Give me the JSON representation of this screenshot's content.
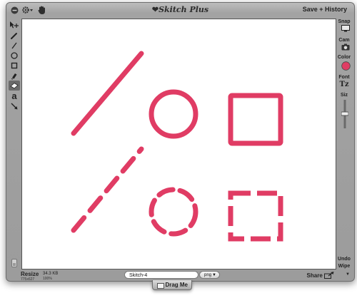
{
  "window": {
    "title": "Skitch Plus",
    "title_heart": "❤",
    "history_button": "Save + History"
  },
  "toolbar": {
    "menu_icon": "circle-menu-icon",
    "settings_icon": "gear-dropdown-icon",
    "hand_icon": "hand-icon"
  },
  "tools": [
    "select-move",
    "pen",
    "line",
    "ellipse",
    "rectangle",
    "marker",
    "eraser",
    "text",
    "arrow"
  ],
  "right_panel": {
    "snap_label": "Snap",
    "cam_label": "Cam",
    "color_label": "Color",
    "color_value": "#e03c64",
    "font_label": "Font",
    "font_glyph": "Tz",
    "size_label": "Siz",
    "undo_label": "Undo",
    "wipe_label": "Wipe"
  },
  "bottom": {
    "resize_label": "Resize",
    "dimensions": "775x627",
    "file_size": "34.3 KB",
    "zoom": "100%",
    "file_name": "Skitch-4",
    "format": "png",
    "share_label": "Share",
    "drag_label": "Drag Me"
  },
  "drawing": {
    "stroke_color": "#e03c64",
    "shapes": [
      "solid-line",
      "solid-circle",
      "solid-square",
      "dashed-line",
      "dashed-circle",
      "dashed-square"
    ]
  }
}
